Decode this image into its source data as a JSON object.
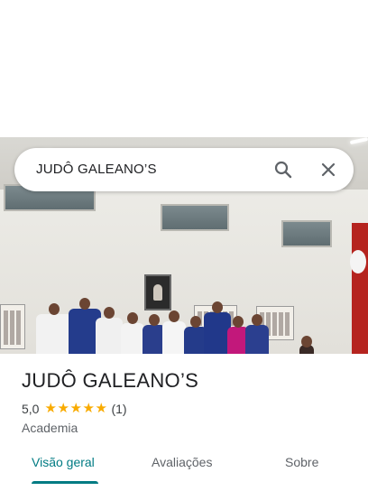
{
  "search": {
    "query": "JUDÔ GALEANO’S"
  },
  "place": {
    "title": "JUDÔ GALEANO’S",
    "rating": "5,0",
    "review_count": "(1)",
    "stars": 5,
    "category": "Academia"
  },
  "tabs": [
    {
      "label": "Visão geral",
      "active": true
    },
    {
      "label": "Avaliações",
      "active": false
    },
    {
      "label": "Sobre",
      "active": false
    }
  ],
  "colors": {
    "accent": "#007b83",
    "star": "#f9ab00",
    "text": "#202124",
    "muted": "#5f6368"
  }
}
